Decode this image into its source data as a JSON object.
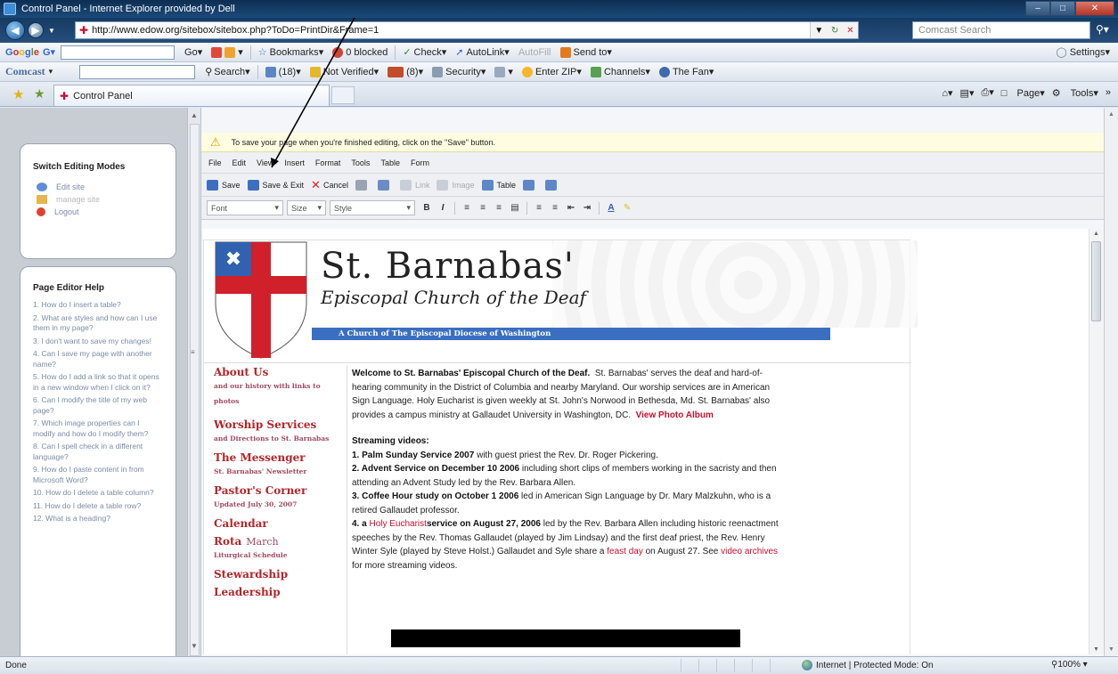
{
  "window": {
    "title": "Control Panel - Internet Explorer provided by Dell"
  },
  "address": {
    "url": "http://www.edow.org/sitebox/sitebox.php?ToDo=PrintDir&Frame=1",
    "search_placeholder": "Comcast Search"
  },
  "google_toolbar": {
    "logo": "Google",
    "items": [
      "Go",
      "Bookmarks",
      "0 blocked",
      "Check",
      "AutoLink",
      "AutoFill",
      "Send to"
    ],
    "settings": "Settings"
  },
  "comcast_toolbar": {
    "logo": "Comcast",
    "items": [
      "Search",
      "(18)",
      "Not Verified",
      "(8)",
      "Security",
      "Enter ZIP",
      "Channels",
      "The Fan"
    ]
  },
  "tabs": {
    "active": "Control Panel"
  },
  "command_bar": {
    "page": "Page",
    "tools": "Tools"
  },
  "left_panel": {
    "modes_title": "Switch Editing Modes",
    "modes": [
      {
        "label": "Edit site",
        "disabled": false
      },
      {
        "label": "manage site",
        "disabled": true
      },
      {
        "label": "Logout",
        "disabled": false
      }
    ],
    "help_title": "Page Editor Help",
    "help_items": [
      "1. How do I insert a table?",
      "2. What are styles and how can I use them in my page?",
      "3. I don't want to save my changes!",
      "4. Can I save my page with another name?",
      "5. How do I add a link so that it opens in a new window when I click on it?",
      "6. Can I modify the title of my web page?",
      "7. Which image properties can I modify and how do I modify them?",
      "8. Can I spell check in a different language?",
      "9. How do I paste content in from Microsoft Word?",
      "10. How do I delete a table column?",
      "11. How do I delete a table row?",
      "12. What is a heading?"
    ]
  },
  "editor": {
    "info_message": "To save your page when you're finished editing, click on the \"Save\" button.",
    "menus": [
      "File",
      "Edit",
      "View",
      "Insert",
      "Format",
      "Tools",
      "Table",
      "Form"
    ],
    "buttons": {
      "save": "Save",
      "save_exit": "Save & Exit",
      "cancel": "Cancel",
      "link": "Link",
      "image": "Image",
      "table": "Table"
    },
    "format": {
      "font": "Font",
      "size": "Size",
      "style": "Style",
      "bold": "B",
      "italic": "I"
    }
  },
  "site": {
    "name": "St. Barnabas'",
    "subtitle": "Episcopal Church of the Deaf",
    "strip": "A Church of The Episcopal Diocese of Washington",
    "nav": [
      {
        "label": "About Us",
        "sub": "and our history with links to photos"
      },
      {
        "label": "Worship Services",
        "sub": "and Directions to St. Barnabas"
      },
      {
        "label": "The Messenger",
        "sub": "St. Barnabas' Newsletter"
      },
      {
        "label": "Pastor's Corner",
        "sub": "Updated July 30, 2007"
      },
      {
        "label": "Calendar",
        "sub": ""
      },
      {
        "label": "Rota",
        "rota_month": "March",
        "sub": "Liturgical Schedule"
      },
      {
        "label": "Stewardship",
        "sub": ""
      },
      {
        "label": "Leadership",
        "sub": ""
      }
    ],
    "welcome_bold": "Welcome to St. Barnabas' Episcopal Church of the Deaf.",
    "welcome_text": "St. Barnabas' serves the deaf and hard-of-hearing community in the District of Columbia and nearby Maryland.  Our worship services are in American Sign Language.  Holy Eucharist is given weekly at St. John's Norwood in Bethesda, Md.  St. Barnabas' also provides a campus ministry at Gallaudet University in Washington, DC.",
    "photo_album": "View Photo Album",
    "streaming_title": "Streaming videos:",
    "videos": [
      {
        "bold": "1. Palm Sunday Service 2007",
        "text": " with guest priest the Rev. Dr. Roger Pickering."
      },
      {
        "bold": "2. Advent Service on December 10 2006",
        "text": " including short clips of members working in the sacristy and then attending an Advent Study led by the Rev. Barbara Allen."
      },
      {
        "bold": "3. Coffee Hour study on October 1 2006",
        "text": " led in American Sign Language by Dr. Mary Malzkuhn, who is a retired Gallaudet professor."
      }
    ],
    "video4_prefix": "4. a ",
    "video4_link": "Holy Eucharist",
    "video4_bold": "service on August 27, 2006",
    "video4_text": " led by the Rev. Barbara Allen including historic reenactment speeches by the Rev. Thomas Gallaudet (played by Jim Lindsay) and the first deaf priest, the Rev. Henry Winter Syle (played by Steve Holst.)  Gallaudet and Syle share a ",
    "feast_day": "feast day",
    "video4_mid": " on August 27.  See ",
    "video_archives": "video archives",
    "video4_end": " for more streaming videos."
  },
  "status": {
    "left": "Done",
    "zone": "Internet | Protected Mode: On",
    "zoom": "100%"
  },
  "colors": {
    "accent_red": "#b3262b",
    "strip_blue": "#3a6ec1",
    "info_bar": "#fffde1"
  }
}
